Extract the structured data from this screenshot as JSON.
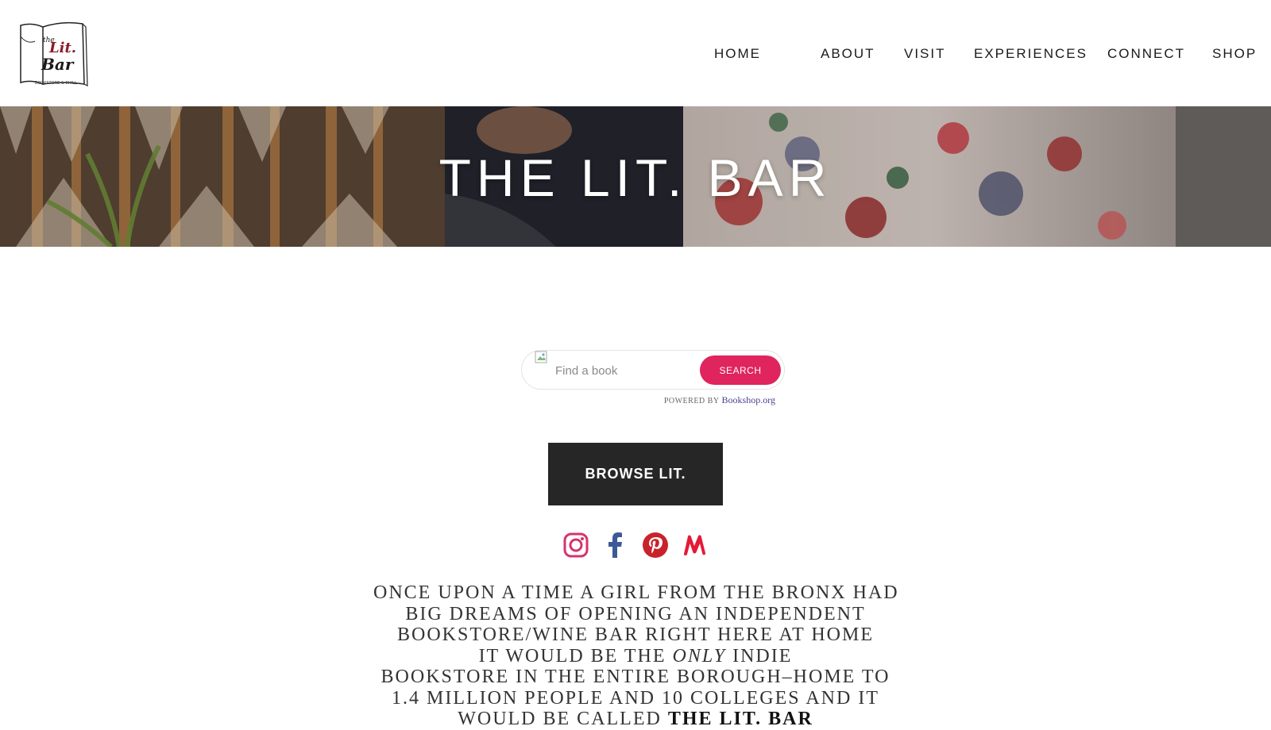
{
  "header": {
    "logo_text": {
      "line1": "the",
      "line2": "Lit.",
      "line3": "Bar",
      "tagline": "BOOKSTORE & CHILL"
    },
    "nav": [
      {
        "label": "HOME"
      },
      {
        "label": "ABOUT"
      },
      {
        "label": "VISIT"
      },
      {
        "label": "EXPERIENCES"
      },
      {
        "label": "CONNECT"
      },
      {
        "label": "SHOP"
      }
    ]
  },
  "hero": {
    "title": "THE LIT. BAR"
  },
  "search": {
    "placeholder": "Find a book",
    "button_label": "SEARCH",
    "powered_label": "POWERED BY",
    "powered_link": "Bookshop.org"
  },
  "browse": {
    "label": "BROWSE LIT."
  },
  "social": [
    {
      "icon": "instagram-icon",
      "color": "#d6336c"
    },
    {
      "icon": "facebook-icon",
      "color": "#3b5998"
    },
    {
      "icon": "pinterest-icon",
      "color": "#c8232c"
    },
    {
      "icon": "meetup-icon",
      "color": "#e51937"
    }
  ],
  "story": {
    "line1": "ONCE UPON A TIME A GIRL FROM THE BRONX HAD",
    "line2": "BIG DREAMS OF OPENING AN INDEPENDENT",
    "line3": "BOOKSTORE/WINE BAR RIGHT HERE AT HOME",
    "line4_pre": "IT WOULD BE THE ",
    "line4_em": "ONLY",
    "line4_post": " INDIE",
    "line5": "BOOKSTORE IN THE ENTIRE BOROUGH–HOME TO",
    "line6": "1.4 MILLION PEOPLE AND 10 COLLEGES AND IT",
    "line7_pre": "WOULD BE CALLED ",
    "line7_bold": "THE LIT. BAR"
  },
  "colors": {
    "accent": "#e0245e",
    "dark_button": "#262626",
    "nav_text": "#1a1a1a"
  }
}
